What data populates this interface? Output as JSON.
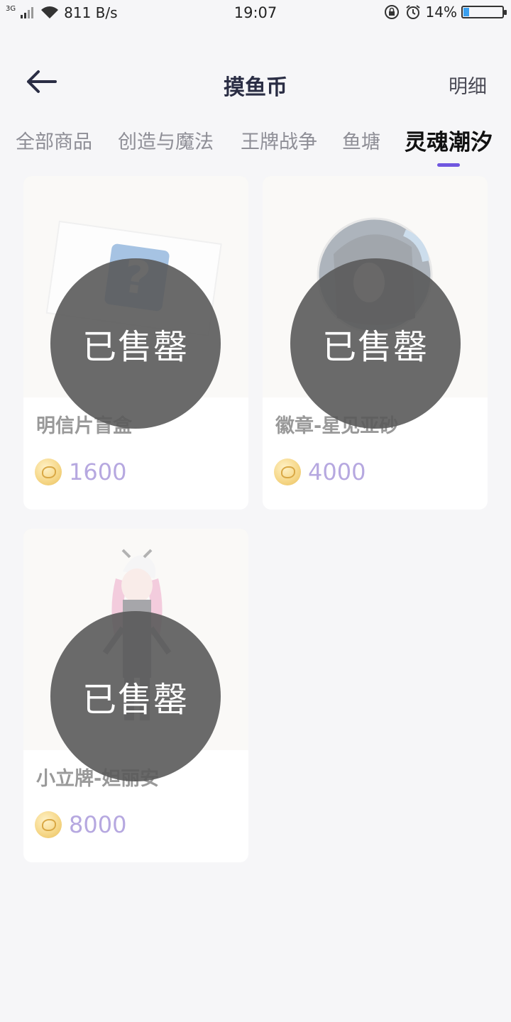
{
  "status_bar": {
    "network_type": "3G",
    "speed": "811 B/s",
    "time": "19:07",
    "battery_percent": "14%",
    "battery_level": 0.14
  },
  "header": {
    "title": "摸鱼币",
    "detail_label": "明细"
  },
  "tabs": [
    {
      "label": "全部商品",
      "active": false
    },
    {
      "label": "创造与魔法",
      "active": false
    },
    {
      "label": "王牌战争",
      "active": false
    },
    {
      "label": "鱼塘",
      "active": false
    },
    {
      "label": "灵魂潮汐",
      "active": true
    }
  ],
  "products": [
    {
      "name": "明信片盲盒",
      "price": "1600",
      "status": "已售罄"
    },
    {
      "name": "徽章-星见亚砂",
      "price": "4000",
      "status": "已售罄"
    },
    {
      "name": "小立牌-妲丽安",
      "price": "8000",
      "status": "已售罄"
    }
  ],
  "colors": {
    "accent": "#7057e0",
    "price": "#b6a8e0",
    "sold_overlay": "#5a5a5a"
  },
  "icons": {
    "back": "arrow-left-icon",
    "coin": "fish-coin-icon"
  }
}
